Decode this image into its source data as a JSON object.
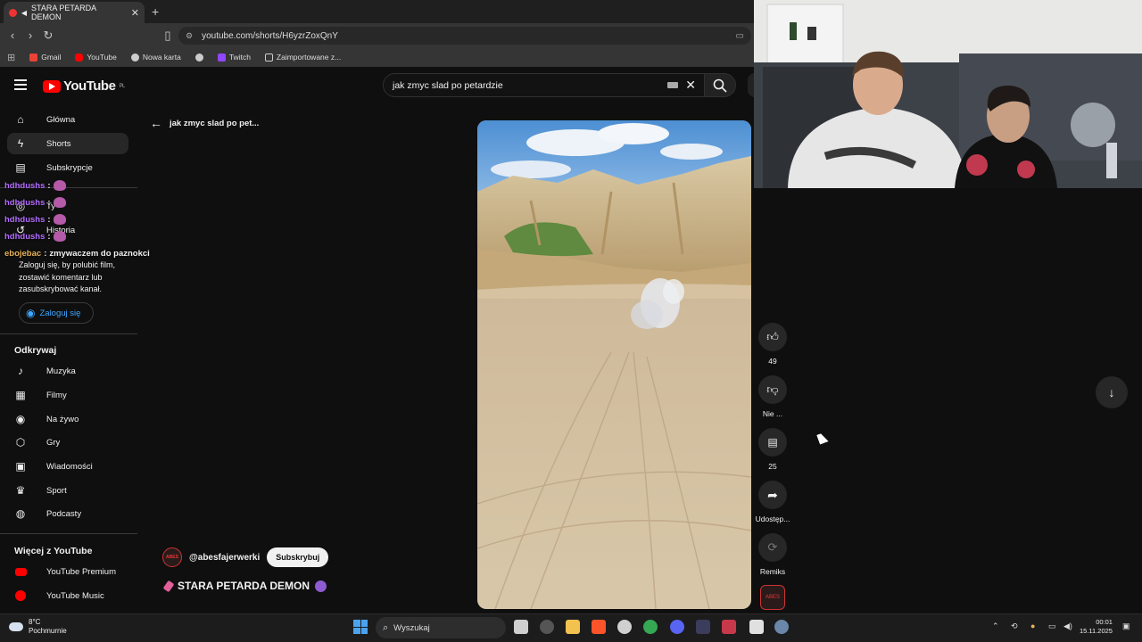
{
  "browser": {
    "tab_title": "STARA PETARDA DEMON",
    "tab_close": "✕",
    "new_tab": "+",
    "url": "youtube.com/shorts/H6yzrZoxQnY",
    "bookmarks": [
      {
        "label": "Gmail",
        "color": "#ea4335"
      },
      {
        "label": "YouTube",
        "color": "#ff0000"
      },
      {
        "label": "Nowa karta",
        "color": "#cccccc"
      },
      {
        "label": "",
        "color": "#cccccc"
      },
      {
        "label": "Twitch",
        "color": "#9146ff"
      },
      {
        "label": "Zaimportowane z...",
        "color": "#cccccc"
      }
    ]
  },
  "youtube": {
    "logo_text": "YouTube",
    "logo_region": "PL",
    "search_query": "jak zmyc slad po petardzie",
    "back_label": "jak zmyc slad po pet...",
    "nav_primary": [
      {
        "label": "Główna",
        "icon": "home-icon"
      },
      {
        "label": "Shorts",
        "icon": "shorts-icon",
        "active": true
      },
      {
        "label": "Subskrypcje",
        "icon": "subscriptions-icon"
      },
      {
        "label": "Ty",
        "icon": "you-icon"
      },
      {
        "label": "Historia",
        "icon": "history-icon"
      }
    ],
    "signin_text": "Zaloguj się, by polubić film, zostawić komentarz lub zasubskrybować kanał.",
    "signin_button": "Zaloguj się",
    "explore_title": "Odkrywaj",
    "explore_items": [
      {
        "label": "Muzyka",
        "icon": "music-icon"
      },
      {
        "label": "Filmy",
        "icon": "film-icon"
      },
      {
        "label": "Na żywo",
        "icon": "live-icon"
      },
      {
        "label": "Gry",
        "icon": "gaming-icon"
      },
      {
        "label": "Wiadomości",
        "icon": "news-icon"
      },
      {
        "label": "Sport",
        "icon": "trophy-icon"
      },
      {
        "label": "Podcasty",
        "icon": "podcast-icon"
      }
    ],
    "more_title": "Więcej z YouTube",
    "more_items": [
      {
        "label": "YouTube Premium"
      },
      {
        "label": "YouTube Music"
      }
    ],
    "short": {
      "channel": "@abesfajerwerki",
      "channel_avatar_text": "ABES",
      "subscribe": "Subskrybuj",
      "title": "STARA PETARDA DEMON",
      "likes": "49",
      "dislike_label": "Nie ...",
      "comments": "25",
      "share_label": "Udostęp...",
      "remix_label": "Remiks"
    }
  },
  "chat": [
    {
      "user": "hdhdushs",
      "message": ""
    },
    {
      "user": "hdhdushs",
      "message": ""
    },
    {
      "user": "hdhdushs",
      "message": ""
    },
    {
      "user": "hdhdushs",
      "message": ""
    },
    {
      "user": "ebojebac",
      "message": "zmywaczem do paznokci"
    }
  ],
  "taskbar": {
    "weather_temp": "8°C",
    "weather_desc": "Pochmurnie",
    "search_label": "Wyszukaj",
    "time": "00:01",
    "date": "15.11.2025"
  }
}
